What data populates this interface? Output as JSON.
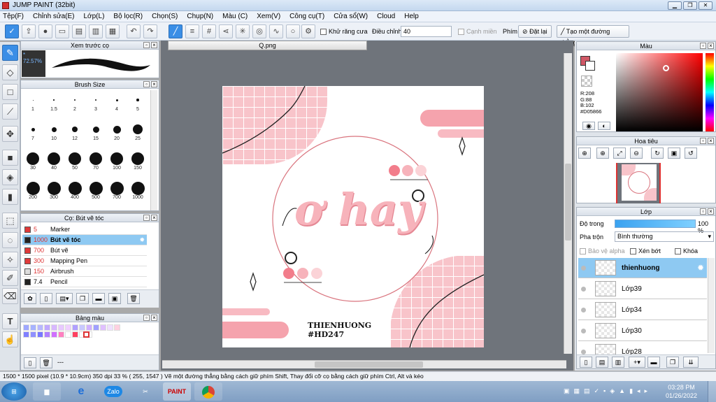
{
  "title": "JUMP PAINT (32bit)",
  "window_buttons": [
    "▁",
    "❐",
    "✕"
  ],
  "menu": [
    "Tệp(F)",
    "Chỉnh sửa(E)",
    "Lớp(L)",
    "Bộ lọc(R)",
    "Chọn(S)",
    "Chụp(N)",
    "Màu (C)",
    "Xem(V)",
    "Công cụ(T)",
    "Cửa sổ(W)",
    "Cloud",
    "Help"
  ],
  "toolbar": {
    "antialias_label": "Khử răng cưa",
    "adjust_label": "Điều chỉnh",
    "adjust_value": "40",
    "snap_label": "Cạnh miền",
    "key_label": "Phím",
    "reset_label": "Đặt lại",
    "line_label": "Tạo một đường thẳng"
  },
  "preview": {
    "title": "Xem trước cọ",
    "zoom": "72.57%"
  },
  "brush_size": {
    "title": "Brush Size",
    "sizes": [
      "1",
      "1.5",
      "2",
      "3",
      "4",
      "5",
      "7",
      "10",
      "12",
      "15",
      "20",
      "25",
      "30",
      "40",
      "50",
      "70",
      "100",
      "150",
      "200",
      "300",
      "400",
      "500",
      "700",
      "1000"
    ]
  },
  "brush_list": {
    "title": "Cọ: Bút vẽ tóc",
    "items": [
      {
        "size": "5",
        "name": "Marker",
        "color": "#e03a3a"
      },
      {
        "size": "1000",
        "name": "Bút vẽ tóc",
        "color": "#222222"
      },
      {
        "size": "700",
        "name": "Bút vẽ",
        "color": "#e03a3a"
      },
      {
        "size": "300",
        "name": "Mapping Pen",
        "color": "#e03a3a"
      },
      {
        "size": "150",
        "name": "Airbrush",
        "color": "#dddddd"
      },
      {
        "size": "7.4",
        "name": "Pencil",
        "color": "#222222"
      }
    ]
  },
  "palette": {
    "title": "Bảng màu",
    "more": "---"
  },
  "doc_tab": "Q.png",
  "artwork": {
    "main_text": "ơ hay",
    "signature_line1": "THIENHUONG",
    "signature_line2": "#HD247"
  },
  "color_panel": {
    "title": "Màu",
    "r": "R:208",
    "g": "G:88",
    "b": "B:102",
    "hex": "#D05866",
    "primary": "#D05866"
  },
  "navigator": {
    "title": "Hoa tiêu"
  },
  "layers": {
    "title": "Lớp",
    "opacity_label": "Độ trong",
    "opacity_value": "100 %",
    "blend_label": "Pha trộn",
    "blend_value": "Bình thường",
    "protect_alpha": "Bảo vệ alpha",
    "clipping": "Xén bớt",
    "lock": "Khóa",
    "items": [
      "thienhuong",
      "Lớp39",
      "Lớp34",
      "Lớp30",
      "Lớp28"
    ]
  },
  "status": "1500 * 1500 pixel   (10.9 * 10.9cm)   350 dpi   33 %   ( 255, 1547 )   Vẽ một đường thẳng bằng cách giữ phím Shift, Thay đổi cỡ cọ bằng cách giữ phím Ctrl, Alt và kéo",
  "taskbar": {
    "time": "03:28 PM",
    "date": "01/26/2022",
    "zalo": "Zalo",
    "jump": "PAINT"
  }
}
